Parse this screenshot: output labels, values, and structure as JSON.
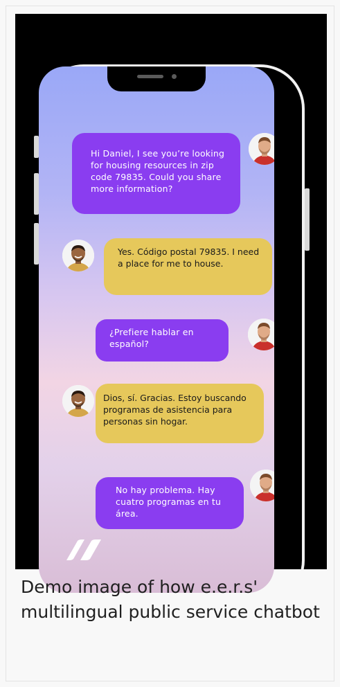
{
  "colors": {
    "bot_bubble": "#8a3df0",
    "user_bubble": "#e6c85b",
    "background": "#000000",
    "caption_text": "#202020"
  },
  "messages": [
    {
      "sender": "bot",
      "text": "Hi Daniel, I see you’re looking for housing resources in zip code 79835. Could you share more information?"
    },
    {
      "sender": "user",
      "text": "Yes. Código postal 79835. I need a place for me to house."
    },
    {
      "sender": "bot",
      "text": "¿Prefiere hablar en español?"
    },
    {
      "sender": "user",
      "text": "Dios, sí. Gracias. Estoy buscando programas de asistencia para personas sin hogar."
    },
    {
      "sender": "bot",
      "text": "No hay problema. Hay cuatro programas en tu área."
    }
  ],
  "icons": {
    "bot_avatar": "agent-avatar-icon",
    "user_avatar": "user-avatar-icon",
    "brand_logo": "double-slash-logo-icon"
  },
  "caption": "Demo image of how e.e.r.s' multilingual public service chatbot"
}
